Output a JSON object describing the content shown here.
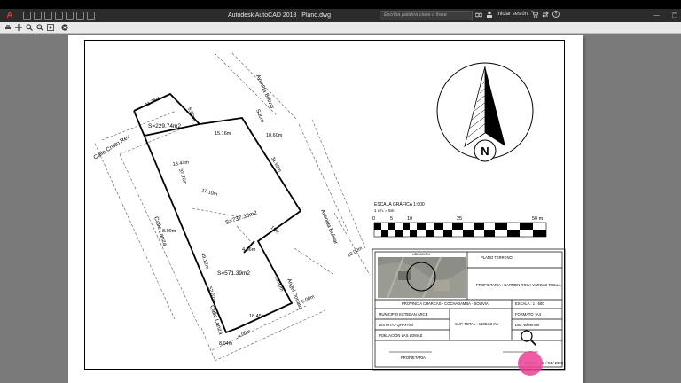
{
  "titlebar": {
    "logo": "A",
    "app_title": "Autodesk AutoCAD 2018",
    "file_name": "Plano.dwg",
    "search_placeholder": "Escriba palabra clave o frase",
    "signin_label": "Iniciar sesión",
    "help_label": "?",
    "minimize": "—",
    "restore": "❐"
  },
  "drawing": {
    "street_1": "Calle Cristo Rey",
    "street_2": "Calle Lanza",
    "street_3": "Avenida Bolivar",
    "street_4": "Angel Donato",
    "street_5": "Sucre",
    "street_6": "Avenida Bolivar",
    "area_1": "S=229.74m2",
    "area_2": "S=737.30m2",
    "area_3": "S=571.39m2",
    "dim_1": "11.76m",
    "dim_2": "15.16m",
    "dim_3": "10.60m",
    "dim_4": "13.44m",
    "dim_5": "31.92m",
    "dim_6": "8.00m",
    "dim_7": "4.56m",
    "dim_8": "15m",
    "dim_9": "17.10m",
    "dim_10": "20.90m",
    "dim_11": "18.45m",
    "dim_12": "8.04m",
    "dim_13": "10.00m",
    "dim_14": "6.00m",
    "dim_15": "4.00m",
    "dim_16": "37.76m",
    "dim_17": "49.12m",
    "dim_18": "52.07m",
    "dim_19": "6.00m",
    "north_label": "N",
    "scale_title": "ESCALA GRÁFICA 1:000",
    "scale_sub": "1 cm. = 5m",
    "scale_ticks": [
      "0",
      "5",
      "10",
      "25",
      "50 m."
    ]
  },
  "titleblock": {
    "location_caption": "UBICACIÓN",
    "plan_title": "PLANO TERRENO",
    "owner": "PROPIETARIA : CARMEN ROSA VARGAS TICLLA",
    "province": "PROVINCIA CHARCAS - COCHABAMBA - BOLIVIA",
    "municipio": "MUNICIPIO ESTEBAN ARCE",
    "distrito": "DISTRITO QHAYANI",
    "poblacion": "POBLACIÓN LAS LOMAS",
    "sup_total": "SUP. TOTAL : 1538.53 m2",
    "escala": "ESCALA : 1 : 500",
    "formato": "FORMATO : A4",
    "dibujo": "DIB: Wbrenner",
    "signature": "PROPIETARIA",
    "fecha": "FECHA : 03 / 04 / 2023"
  }
}
